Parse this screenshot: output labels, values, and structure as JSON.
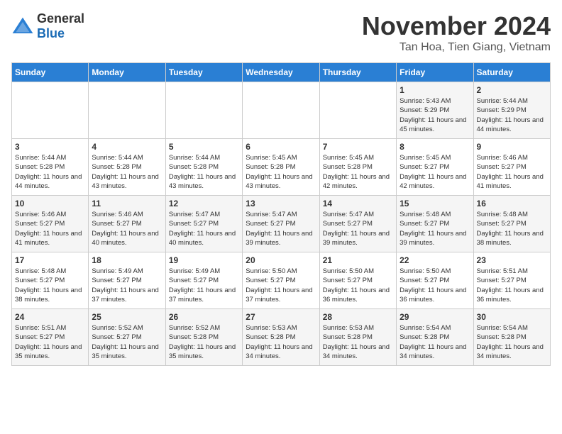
{
  "logo": {
    "general": "General",
    "blue": "Blue"
  },
  "title": "November 2024",
  "location": "Tan Hoa, Tien Giang, Vietnam",
  "days_of_week": [
    "Sunday",
    "Monday",
    "Tuesday",
    "Wednesday",
    "Thursday",
    "Friday",
    "Saturday"
  ],
  "weeks": [
    [
      {
        "day": "",
        "info": ""
      },
      {
        "day": "",
        "info": ""
      },
      {
        "day": "",
        "info": ""
      },
      {
        "day": "",
        "info": ""
      },
      {
        "day": "",
        "info": ""
      },
      {
        "day": "1",
        "info": "Sunrise: 5:43 AM\nSunset: 5:29 PM\nDaylight: 11 hours and 45 minutes."
      },
      {
        "day": "2",
        "info": "Sunrise: 5:44 AM\nSunset: 5:29 PM\nDaylight: 11 hours and 44 minutes."
      }
    ],
    [
      {
        "day": "3",
        "info": "Sunrise: 5:44 AM\nSunset: 5:28 PM\nDaylight: 11 hours and 44 minutes."
      },
      {
        "day": "4",
        "info": "Sunrise: 5:44 AM\nSunset: 5:28 PM\nDaylight: 11 hours and 43 minutes."
      },
      {
        "day": "5",
        "info": "Sunrise: 5:44 AM\nSunset: 5:28 PM\nDaylight: 11 hours and 43 minutes."
      },
      {
        "day": "6",
        "info": "Sunrise: 5:45 AM\nSunset: 5:28 PM\nDaylight: 11 hours and 43 minutes."
      },
      {
        "day": "7",
        "info": "Sunrise: 5:45 AM\nSunset: 5:28 PM\nDaylight: 11 hours and 42 minutes."
      },
      {
        "day": "8",
        "info": "Sunrise: 5:45 AM\nSunset: 5:27 PM\nDaylight: 11 hours and 42 minutes."
      },
      {
        "day": "9",
        "info": "Sunrise: 5:46 AM\nSunset: 5:27 PM\nDaylight: 11 hours and 41 minutes."
      }
    ],
    [
      {
        "day": "10",
        "info": "Sunrise: 5:46 AM\nSunset: 5:27 PM\nDaylight: 11 hours and 41 minutes."
      },
      {
        "day": "11",
        "info": "Sunrise: 5:46 AM\nSunset: 5:27 PM\nDaylight: 11 hours and 40 minutes."
      },
      {
        "day": "12",
        "info": "Sunrise: 5:47 AM\nSunset: 5:27 PM\nDaylight: 11 hours and 40 minutes."
      },
      {
        "day": "13",
        "info": "Sunrise: 5:47 AM\nSunset: 5:27 PM\nDaylight: 11 hours and 39 minutes."
      },
      {
        "day": "14",
        "info": "Sunrise: 5:47 AM\nSunset: 5:27 PM\nDaylight: 11 hours and 39 minutes."
      },
      {
        "day": "15",
        "info": "Sunrise: 5:48 AM\nSunset: 5:27 PM\nDaylight: 11 hours and 39 minutes."
      },
      {
        "day": "16",
        "info": "Sunrise: 5:48 AM\nSunset: 5:27 PM\nDaylight: 11 hours and 38 minutes."
      }
    ],
    [
      {
        "day": "17",
        "info": "Sunrise: 5:48 AM\nSunset: 5:27 PM\nDaylight: 11 hours and 38 minutes."
      },
      {
        "day": "18",
        "info": "Sunrise: 5:49 AM\nSunset: 5:27 PM\nDaylight: 11 hours and 37 minutes."
      },
      {
        "day": "19",
        "info": "Sunrise: 5:49 AM\nSunset: 5:27 PM\nDaylight: 11 hours and 37 minutes."
      },
      {
        "day": "20",
        "info": "Sunrise: 5:50 AM\nSunset: 5:27 PM\nDaylight: 11 hours and 37 minutes."
      },
      {
        "day": "21",
        "info": "Sunrise: 5:50 AM\nSunset: 5:27 PM\nDaylight: 11 hours and 36 minutes."
      },
      {
        "day": "22",
        "info": "Sunrise: 5:50 AM\nSunset: 5:27 PM\nDaylight: 11 hours and 36 minutes."
      },
      {
        "day": "23",
        "info": "Sunrise: 5:51 AM\nSunset: 5:27 PM\nDaylight: 11 hours and 36 minutes."
      }
    ],
    [
      {
        "day": "24",
        "info": "Sunrise: 5:51 AM\nSunset: 5:27 PM\nDaylight: 11 hours and 35 minutes."
      },
      {
        "day": "25",
        "info": "Sunrise: 5:52 AM\nSunset: 5:27 PM\nDaylight: 11 hours and 35 minutes."
      },
      {
        "day": "26",
        "info": "Sunrise: 5:52 AM\nSunset: 5:28 PM\nDaylight: 11 hours and 35 minutes."
      },
      {
        "day": "27",
        "info": "Sunrise: 5:53 AM\nSunset: 5:28 PM\nDaylight: 11 hours and 34 minutes."
      },
      {
        "day": "28",
        "info": "Sunrise: 5:53 AM\nSunset: 5:28 PM\nDaylight: 11 hours and 34 minutes."
      },
      {
        "day": "29",
        "info": "Sunrise: 5:54 AM\nSunset: 5:28 PM\nDaylight: 11 hours and 34 minutes."
      },
      {
        "day": "30",
        "info": "Sunrise: 5:54 AM\nSunset: 5:28 PM\nDaylight: 11 hours and 34 minutes."
      }
    ]
  ]
}
